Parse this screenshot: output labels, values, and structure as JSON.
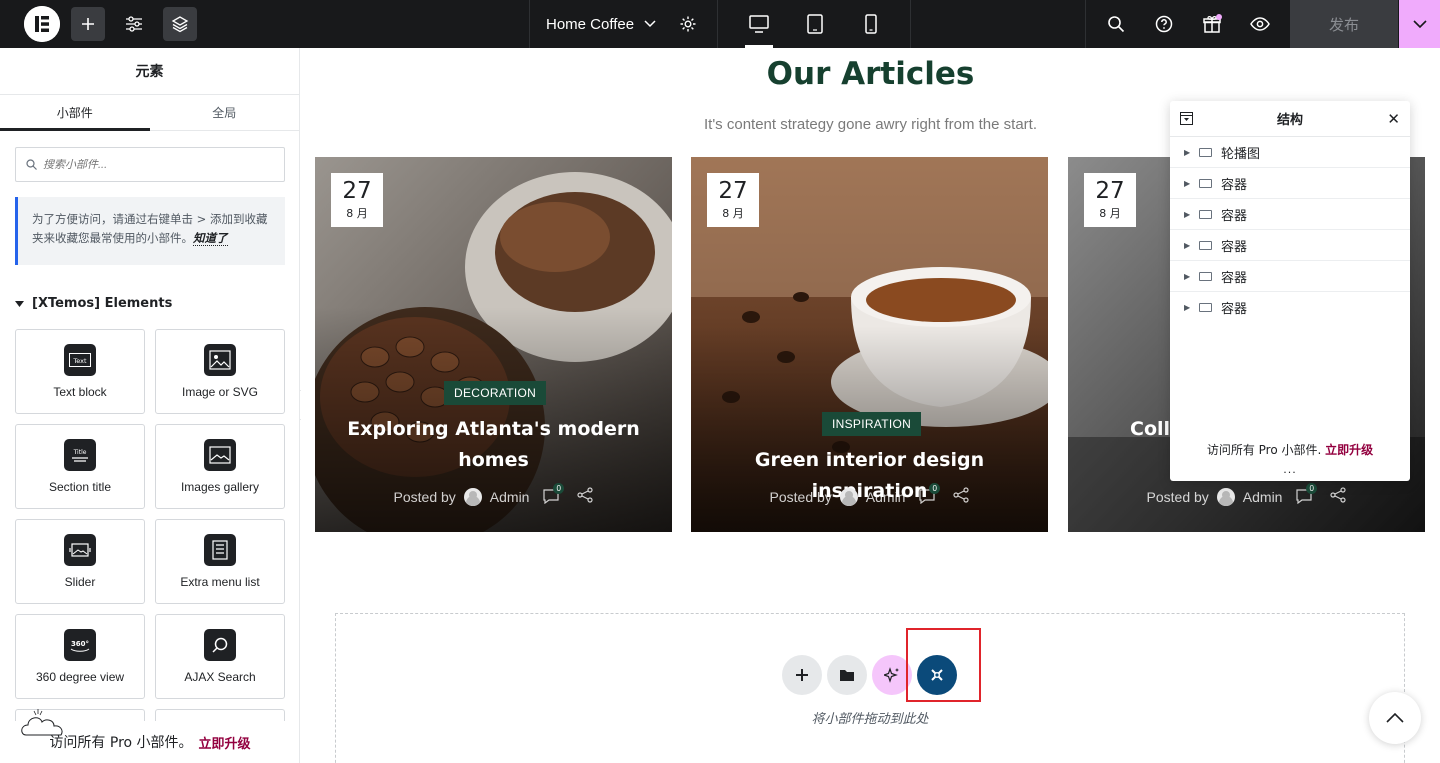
{
  "topbar": {
    "page_name": "Home Coffee",
    "publish_label": "发布",
    "accent_color": "#f0abfc"
  },
  "panel": {
    "title": "元素",
    "tabs": [
      {
        "label": "小部件",
        "active": true
      },
      {
        "label": "全局",
        "active": false
      }
    ],
    "search_placeholder": "搜索小部件...",
    "tip_text": "为了方便访问，请通过右键单击 > 添加到收藏夹来收藏您最常使用的小部件。",
    "tip_link": "知道了",
    "category": "[XTemos] Elements",
    "widgets": [
      {
        "label": "Text block",
        "icon": "text-block-icon"
      },
      {
        "label": "Image or SVG",
        "icon": "image-icon"
      },
      {
        "label": "Section title",
        "icon": "section-title-icon"
      },
      {
        "label": "Images gallery",
        "icon": "gallery-icon"
      },
      {
        "label": "Slider",
        "icon": "slider-icon"
      },
      {
        "label": "Extra menu list",
        "icon": "menu-list-icon"
      },
      {
        "label": "360 degree view",
        "icon": "360-view-icon"
      },
      {
        "label": "AJAX Search",
        "icon": "search-icon"
      }
    ],
    "pro_text": "访问所有 Pro 小部件。",
    "pro_link": "立即升级"
  },
  "canvas": {
    "heading": "Our Articles",
    "subheading": "It's content strategy gone awry right from the start.",
    "posts": [
      {
        "day": "27",
        "month": "8 月",
        "category": "DECORATION",
        "title_line1": "Exploring Atlanta's modern",
        "title_line2": "homes",
        "posted_by": "Posted by",
        "author": "Admin",
        "comments": "0"
      },
      {
        "day": "27",
        "month": "8 月",
        "category": "INSPIRATION",
        "title_line1": "Green interior design inspiration",
        "title_line2": "",
        "posted_by": "Posted by",
        "author": "Admin",
        "comments": "0"
      },
      {
        "day": "27",
        "month": "8 月",
        "category": "",
        "title_line1": "Colle",
        "title_line2": "",
        "posted_by": "Posted by",
        "author": "Admin",
        "comments": "0"
      }
    ],
    "drop_label": "将小部件拖动到此处"
  },
  "structure": {
    "title": "结构",
    "items": [
      {
        "label": "轮播图"
      },
      {
        "label": "容器"
      },
      {
        "label": "容器"
      },
      {
        "label": "容器"
      },
      {
        "label": "容器"
      },
      {
        "label": "容器"
      }
    ],
    "footer_text": "访问所有 Pro 小部件.",
    "footer_link": "立即升级",
    "more": "..."
  }
}
